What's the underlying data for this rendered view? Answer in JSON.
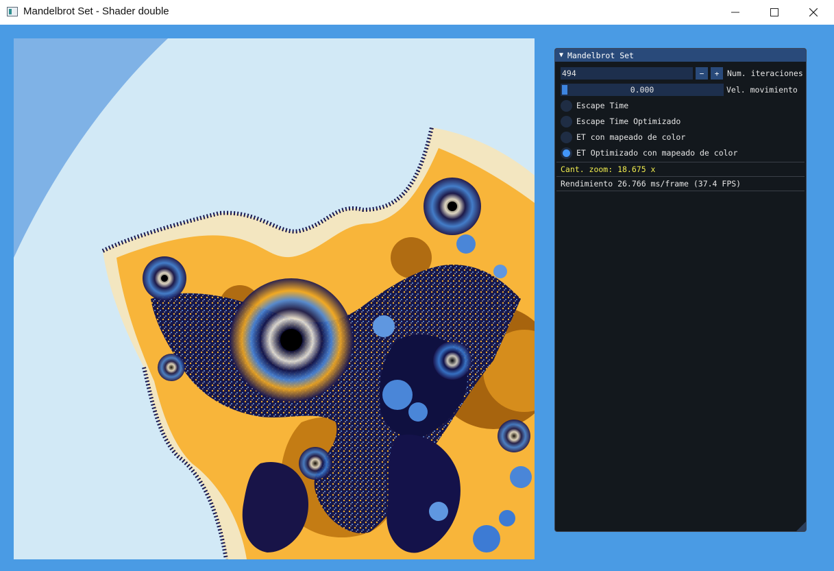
{
  "window": {
    "title": "Mandelbrot Set - Shader double",
    "controls": {
      "minimize": "—",
      "maximize": "☐",
      "close": "✕"
    }
  },
  "panel": {
    "title": "Mandelbrot Set",
    "iterations": {
      "value": "494",
      "minus": "−",
      "plus": "+",
      "label": "Num. iteraciones"
    },
    "speed": {
      "value": "0.000",
      "label": "Vel. movimiento"
    },
    "modes": [
      {
        "label": "Escape Time",
        "selected": false
      },
      {
        "label": "Escape Time Optimizado",
        "selected": false
      },
      {
        "label": "ET con mapeado de color",
        "selected": false
      },
      {
        "label": "ET Optimizado con mapeado de color",
        "selected": true
      }
    ],
    "zoom_text": "Cant. zoom: 18.675 x",
    "performance_text": "Rendimiento 26.766 ms/frame (37.4 FPS)"
  },
  "colors": {
    "client_background": "#4a9be4",
    "panel_background": "#13181d",
    "panel_header": "#294a7a",
    "radio_selected": "#4296fa",
    "zoom_text": "#f0ec4e"
  }
}
